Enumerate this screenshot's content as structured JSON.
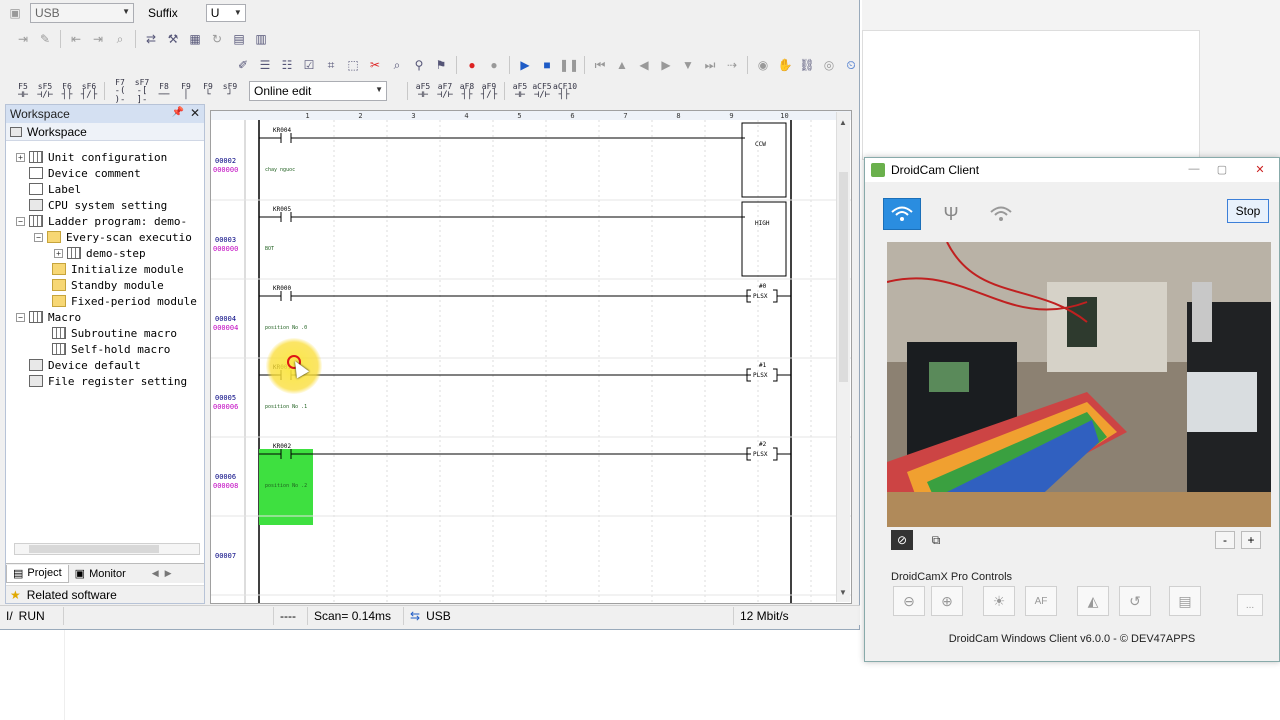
{
  "toolbar": {
    "connection_value": "USB",
    "suffix_label": "Suffix",
    "suffix_value": "U",
    "mode_value": "Online edit",
    "fkeys": [
      "F5",
      "sF5",
      "F6",
      "sF6",
      "F7",
      "sF7",
      "F8",
      "F9",
      "F9",
      "sF9"
    ],
    "fkeys2": [
      "aF5",
      "aF7",
      "aF8",
      "aF9",
      "aF5",
      "aCF5",
      "aCF10"
    ]
  },
  "workspace": {
    "panel_title": "Workspace",
    "root_label": "Workspace",
    "items": [
      {
        "label": "Unit configuration"
      },
      {
        "label": "Device comment"
      },
      {
        "label": "Label"
      },
      {
        "label": "CPU system setting"
      },
      {
        "label": "Ladder program: demo-"
      },
      {
        "label": "Every-scan executio"
      },
      {
        "label": "demo-step"
      },
      {
        "label": "Initialize module"
      },
      {
        "label": "Standby module"
      },
      {
        "label": "Fixed-period module"
      },
      {
        "label": "Macro"
      },
      {
        "label": "Subroutine macro"
      },
      {
        "label": "Self-hold macro"
      },
      {
        "label": "Device default"
      },
      {
        "label": "File register setting"
      }
    ],
    "tab_project": "Project",
    "tab_monitor": "Monitor",
    "related": "Related software"
  },
  "ladder": {
    "columns": [
      "1",
      "2",
      "3",
      "4",
      "5",
      "6",
      "7",
      "8",
      "9",
      "10"
    ],
    "rungs": [
      {
        "number": "00002",
        "address": "000000",
        "contact": "KR004",
        "comment": "chay nguoc",
        "coil": "CCW"
      },
      {
        "number": "00003",
        "address": "000000",
        "contact": "KR005",
        "comment": "BOT",
        "coil": "HIGH"
      },
      {
        "number": "00004",
        "address": "000004",
        "contact": "KR000",
        "comment": "position No .0",
        "coil_top": "#0",
        "coil": "PLSX"
      },
      {
        "number": "00005",
        "address": "000006",
        "contact": "KR001",
        "comment": "position No .1",
        "coil_top": "#1",
        "coil": "PLSX"
      },
      {
        "number": "00006",
        "address": "000008",
        "contact": "KR002",
        "comment": "position No .2",
        "coil_top": "#2",
        "coil": "PLSX"
      },
      {
        "number": "00007",
        "address": "",
        "contact": "",
        "comment": "",
        "coil": ""
      }
    ]
  },
  "status": {
    "mode": "RUN",
    "dashes": "----",
    "scan": "Scan=  0.14ms",
    "connection": "USB",
    "speed": "12 Mbit/s"
  },
  "droidcam": {
    "title": "DroidCam Client",
    "stop_label": "Stop",
    "pro_controls_label": "DroidCamX Pro Controls",
    "af_label": "AF",
    "footer": "DroidCam Windows Client v6.0.0 - © DEV47APPS",
    "zoom_minus": "-",
    "zoom_plus": "+",
    "more": "..."
  }
}
